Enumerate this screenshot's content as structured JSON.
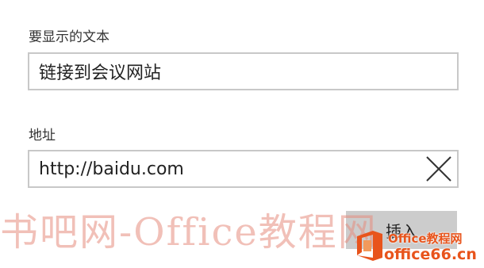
{
  "form": {
    "display_text_label": "要显示的文本",
    "display_text_value": "链接到会议网站",
    "address_label": "地址",
    "address_value": "http://baidu.com",
    "insert_label": "插入"
  },
  "watermark": {
    "text": "书吧网-Office教程网"
  },
  "logo": {
    "top_text": "Office教程网",
    "bottom_text": "office66.cn",
    "icon": "office-logo-icon",
    "color": "#e8541c"
  },
  "icons": {
    "clear": "close-icon"
  }
}
